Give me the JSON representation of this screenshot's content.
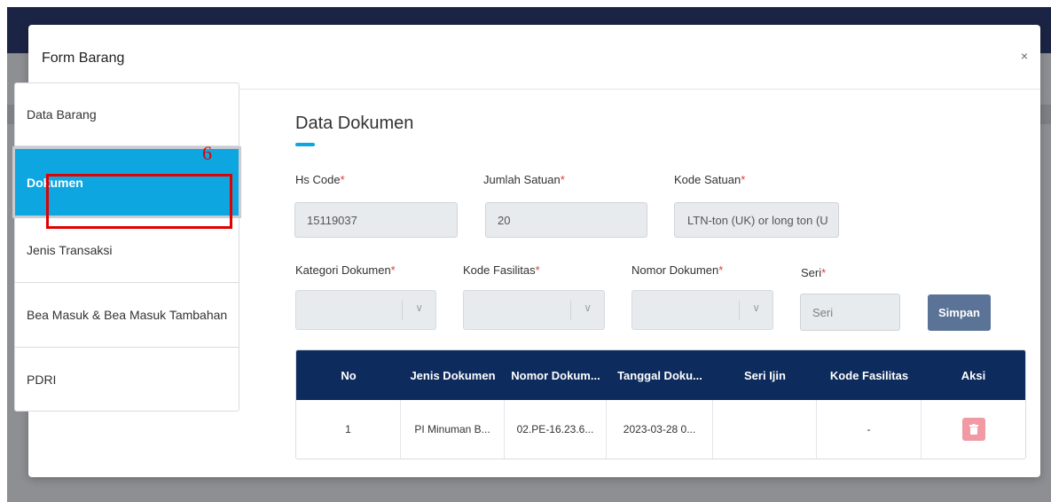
{
  "modal": {
    "title": "Form Barang",
    "close": "×"
  },
  "annotation": {
    "number": "6"
  },
  "sidebar": {
    "items": [
      {
        "label": "Data Barang"
      },
      {
        "label": "Dokumen"
      },
      {
        "label": "Jenis Transaksi"
      },
      {
        "label": "Bea Masuk & Bea Masuk Tambahan"
      },
      {
        "label": "PDRI"
      }
    ],
    "active_index": 1
  },
  "content": {
    "title": "Data Dokumen",
    "required_mark": "*",
    "hs_code": {
      "label": "Hs Code",
      "value": "15119037"
    },
    "jumlah_satuan": {
      "label": "Jumlah Satuan",
      "value": "20"
    },
    "kode_satuan": {
      "label": "Kode Satuan",
      "value": "LTN-ton (UK) or long ton (U"
    },
    "kategori_dokumen": {
      "label": "Kategori Dokumen",
      "value": ""
    },
    "kode_fasilitas": {
      "label": "Kode Fasilitas",
      "value": ""
    },
    "nomor_dokumen": {
      "label": "Nomor Dokumen",
      "value": ""
    },
    "seri": {
      "label": "Seri",
      "placeholder": "Seri"
    },
    "simpan_label": "Simpan"
  },
  "table": {
    "headers": [
      "No",
      "Jenis Dokumen",
      "Nomor Dokum...",
      "Tanggal Doku...",
      "Seri Ijin",
      "Kode Fasilitas",
      "Aksi"
    ],
    "rows": [
      {
        "no": "1",
        "jenis": "PI Minuman B...",
        "nomor": "02.PE-16.23.6...",
        "tanggal": "2023-03-28 0...",
        "seri_ijin": "",
        "kode_fasilitas": "-"
      }
    ]
  },
  "colors": {
    "accent": "#0ea6e0",
    "table_header": "#0d2b5c",
    "button_simpan": "#5a7396",
    "delete_button": "#f29aa4",
    "annotation": "#e00000"
  },
  "icons": {
    "close": "close-icon",
    "select_arrow": "chevron-down-icon",
    "delete": "trash-icon"
  }
}
